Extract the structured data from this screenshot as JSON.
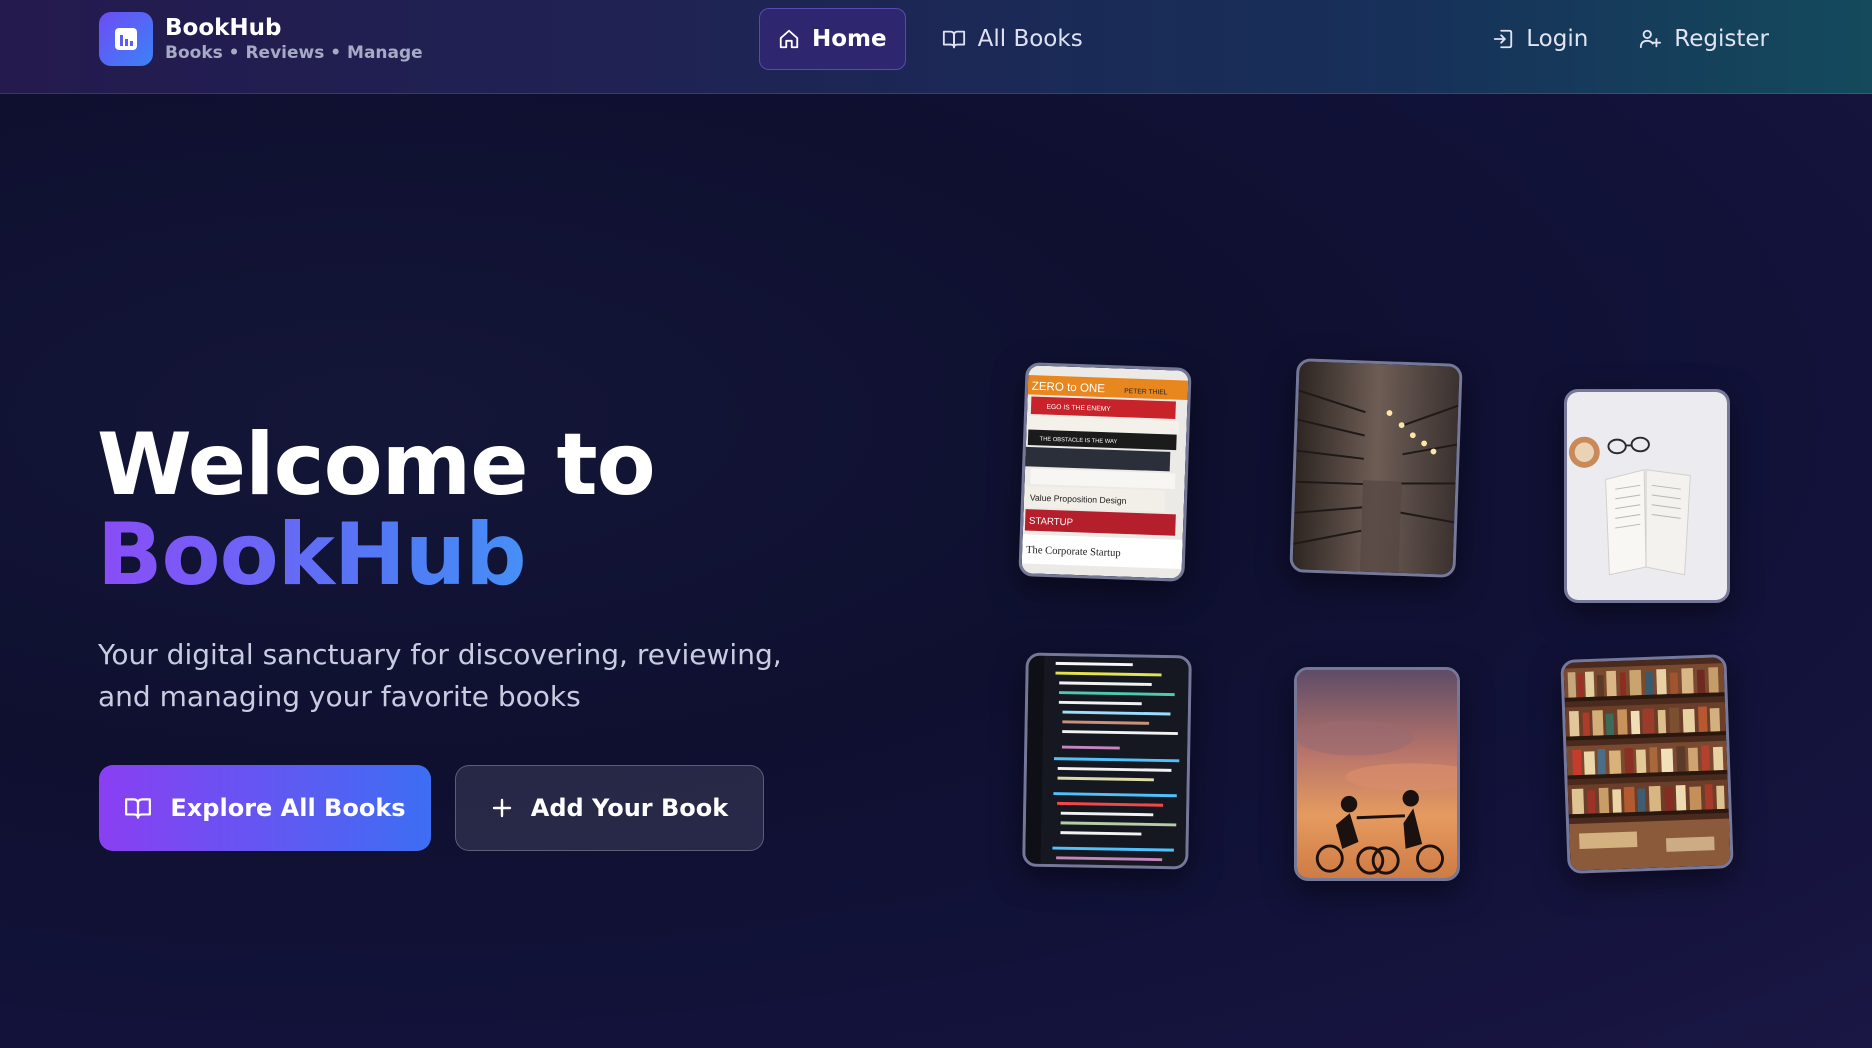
{
  "brand": {
    "title": "BookHub",
    "subtitle": "Books • Reviews • Manage",
    "logo_icon": "bar-chart-icon"
  },
  "nav": {
    "home_label": "Home",
    "all_books_label": "All Books",
    "login_label": "Login",
    "register_label": "Register"
  },
  "hero": {
    "title_line1": "Welcome to",
    "title_line2": "BookHub",
    "subtitle": "Your digital sanctuary for discovering, reviewing, and managing your favorite books",
    "explore_label": "Explore All Books",
    "add_label": "Add Your Book"
  },
  "colors": {
    "accent_purple": "#8a3ff2",
    "accent_blue": "#3d6ef3",
    "background": "#0f1030"
  },
  "cards": {
    "book_stack": {
      "spine1": "ZERO to ONE",
      "spine1_author": "PETER THIEL",
      "spine2": "EGO IS THE ENEMY",
      "spine3": "THE OBSTACLE IS THE WAY",
      "spine4": "Value Proposition Design",
      "spine5": "STARTUP",
      "spine6": "The Corporate Startup"
    }
  }
}
